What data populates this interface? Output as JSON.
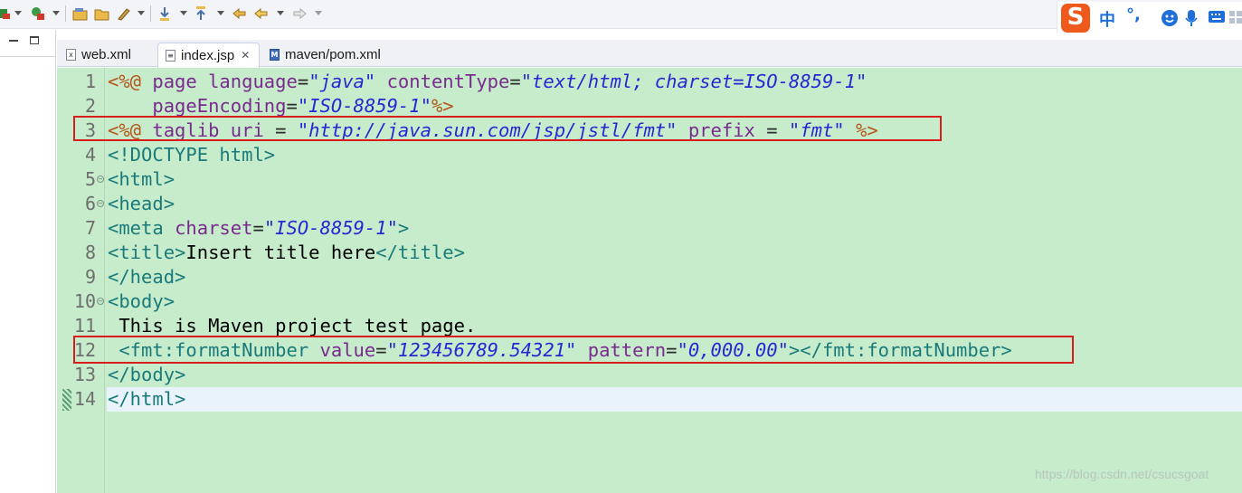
{
  "tabs": [
    {
      "label": "web.xml",
      "icon": "xml-file-icon",
      "active": false
    },
    {
      "label": "index.jsp",
      "icon": "jsp-file-icon",
      "active": true
    },
    {
      "label": "maven/pom.xml",
      "icon": "maven-pom-icon",
      "active": false
    }
  ],
  "ime": {
    "logo": "S",
    "mode": "中",
    "punct": "°,"
  },
  "lines": [
    {
      "num": "1",
      "fold": false,
      "marker": false,
      "current": false,
      "segments": [
        {
          "t": "<%@",
          "c": "dir"
        },
        {
          "t": " ",
          "c": "def"
        },
        {
          "t": "page",
          "c": "kw"
        },
        {
          "t": " ",
          "c": "def"
        },
        {
          "t": "language",
          "c": "kw"
        },
        {
          "t": "=",
          "c": "def"
        },
        {
          "t": "\"java\"",
          "c": "str"
        },
        {
          "t": " ",
          "c": "def"
        },
        {
          "t": "contentType",
          "c": "kw"
        },
        {
          "t": "=",
          "c": "def"
        },
        {
          "t": "\"text/html; charset=ISO-8859-1\"",
          "c": "str"
        }
      ]
    },
    {
      "num": "2",
      "fold": false,
      "marker": false,
      "current": false,
      "segments": [
        {
          "t": "    ",
          "c": "def"
        },
        {
          "t": "pageEncoding",
          "c": "kw"
        },
        {
          "t": "=",
          "c": "def"
        },
        {
          "t": "\"ISO-8859-1\"",
          "c": "str"
        },
        {
          "t": "%>",
          "c": "dir"
        }
      ]
    },
    {
      "num": "3",
      "fold": false,
      "marker": false,
      "current": false,
      "segments": [
        {
          "t": "<%@",
          "c": "dir"
        },
        {
          "t": " ",
          "c": "def"
        },
        {
          "t": "taglib",
          "c": "kw"
        },
        {
          "t": " ",
          "c": "def"
        },
        {
          "t": "uri",
          "c": "kw"
        },
        {
          "t": " = ",
          "c": "def"
        },
        {
          "t": "\"http://java.sun.com/jsp/jstl/fmt\"",
          "c": "str"
        },
        {
          "t": " ",
          "c": "def"
        },
        {
          "t": "prefix",
          "c": "kw"
        },
        {
          "t": " = ",
          "c": "def"
        },
        {
          "t": "\"fmt\"",
          "c": "str"
        },
        {
          "t": " ",
          "c": "def"
        },
        {
          "t": "%>",
          "c": "dir"
        }
      ]
    },
    {
      "num": "4",
      "fold": false,
      "marker": false,
      "current": false,
      "segments": [
        {
          "t": "<!DOCTYPE html>",
          "c": "tag"
        }
      ]
    },
    {
      "num": "5",
      "fold": true,
      "marker": false,
      "current": false,
      "segments": [
        {
          "t": "<html>",
          "c": "tag"
        }
      ]
    },
    {
      "num": "6",
      "fold": true,
      "marker": false,
      "current": false,
      "segments": [
        {
          "t": "<head>",
          "c": "tag"
        }
      ]
    },
    {
      "num": "7",
      "fold": false,
      "marker": false,
      "current": false,
      "segments": [
        {
          "t": "<meta",
          "c": "tag"
        },
        {
          "t": " ",
          "c": "def"
        },
        {
          "t": "charset",
          "c": "kw"
        },
        {
          "t": "=",
          "c": "def"
        },
        {
          "t": "\"ISO-8859-1\"",
          "c": "str"
        },
        {
          "t": ">",
          "c": "tag"
        }
      ]
    },
    {
      "num": "8",
      "fold": false,
      "marker": false,
      "current": false,
      "segments": [
        {
          "t": "<title>",
          "c": "tag"
        },
        {
          "t": "Insert title here",
          "c": "txt"
        },
        {
          "t": "</title>",
          "c": "tag"
        }
      ]
    },
    {
      "num": "9",
      "fold": false,
      "marker": false,
      "current": false,
      "segments": [
        {
          "t": "</head>",
          "c": "tag"
        }
      ]
    },
    {
      "num": "10",
      "fold": true,
      "marker": false,
      "current": false,
      "segments": [
        {
          "t": "<body>",
          "c": "tag"
        }
      ]
    },
    {
      "num": "11",
      "fold": false,
      "marker": false,
      "current": false,
      "segments": [
        {
          "t": " This is Maven project test page.",
          "c": "txt"
        }
      ]
    },
    {
      "num": "12",
      "fold": false,
      "marker": false,
      "current": false,
      "segments": [
        {
          "t": " ",
          "c": "def"
        },
        {
          "t": "<fmt:formatNumber",
          "c": "tag"
        },
        {
          "t": " ",
          "c": "def"
        },
        {
          "t": "value",
          "c": "kw"
        },
        {
          "t": "=",
          "c": "def"
        },
        {
          "t": "\"123456789.54321\"",
          "c": "str"
        },
        {
          "t": " ",
          "c": "def"
        },
        {
          "t": "pattern",
          "c": "kw"
        },
        {
          "t": "=",
          "c": "def"
        },
        {
          "t": "\"0,000.00\"",
          "c": "str"
        },
        {
          "t": "></fmt:formatNumber>",
          "c": "tag"
        }
      ]
    },
    {
      "num": "13",
      "fold": false,
      "marker": false,
      "current": false,
      "segments": [
        {
          "t": "</body>",
          "c": "tag"
        }
      ]
    },
    {
      "num": "14",
      "fold": false,
      "marker": true,
      "current": true,
      "segments": [
        {
          "t": "</html>",
          "c": "tag"
        }
      ]
    }
  ],
  "highlight_boxes": [
    {
      "line": "3"
    },
    {
      "line": "12"
    }
  ],
  "watermark": "https://blog.csdn.net/csucsgoat"
}
